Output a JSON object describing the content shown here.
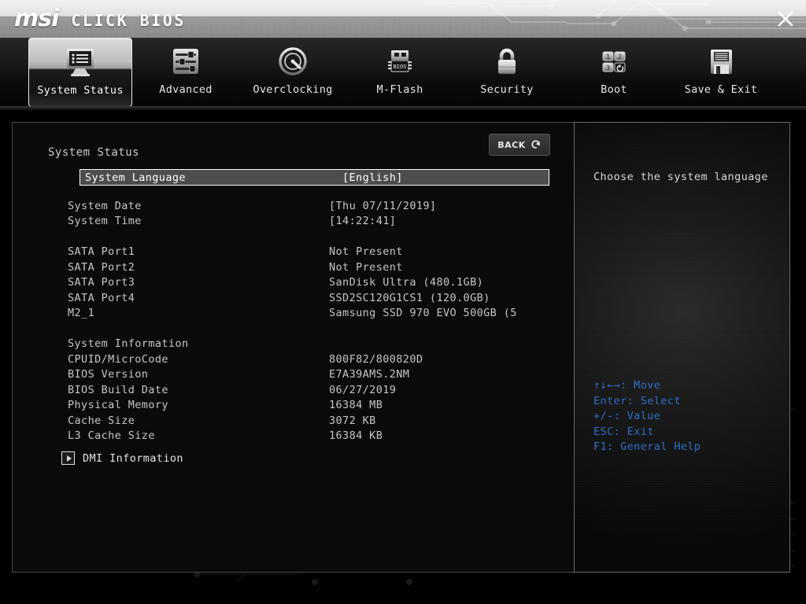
{
  "header": {
    "logo_msi": "msi",
    "logo_click_bios": "CLICK BIOS",
    "close_icon": "close-icon"
  },
  "nav": {
    "items": [
      {
        "label": "System Status",
        "icon": "monitor-list-icon",
        "active": true
      },
      {
        "label": "Advanced",
        "icon": "sliders-icon",
        "active": false
      },
      {
        "label": "Overclocking",
        "icon": "speedometer-icon",
        "active": false
      },
      {
        "label": "M-Flash",
        "icon": "bios-chip-icon",
        "active": false
      },
      {
        "label": "Security",
        "icon": "padlock-icon",
        "active": false
      },
      {
        "label": "Boot",
        "icon": "boot-order-icon",
        "active": false
      },
      {
        "label": "Save & Exit",
        "icon": "floppy-disk-icon",
        "active": false
      }
    ]
  },
  "main": {
    "title": "System Status",
    "back_button": {
      "label": "BACK",
      "icon": "undo-arrow-icon"
    },
    "highlighted_row": {
      "label": "System Language",
      "value": "[English]"
    },
    "rows": [
      {
        "label": "System Date",
        "value": "[Thu 07/11/2019]"
      },
      {
        "label": "System Time",
        "value": "[14:22:41]"
      },
      {
        "label": "",
        "value": ""
      },
      {
        "label": "SATA Port1",
        "value": "Not Present"
      },
      {
        "label": "SATA Port2",
        "value": "Not Present"
      },
      {
        "label": "SATA Port3",
        "value": "SanDisk Ultra  (480.1GB)"
      },
      {
        "label": "SATA Port4",
        "value": "SSD2SC120G1CS1 (120.0GB)"
      },
      {
        "label": "M2_1",
        "value": "Samsung SSD 970 EVO 500GB (5"
      },
      {
        "label": "",
        "value": ""
      },
      {
        "label": "System Information",
        "value": ""
      },
      {
        "label": "CPUID/MicroCode",
        "value": "800F82/800820D"
      },
      {
        "label": "BIOS Version",
        "value": "E7A39AMS.2NM"
      },
      {
        "label": "BIOS Build Date",
        "value": "06/27/2019"
      },
      {
        "label": "Physical Memory",
        "value": "16384 MB"
      },
      {
        "label": "Cache Size",
        "value": "3072 KB"
      },
      {
        "label": "L3 Cache Size",
        "value": "16384 KB"
      }
    ],
    "dmi": {
      "label": "DMI Information",
      "icon": "expand-triangle-icon"
    }
  },
  "help": {
    "description": "Choose the system language",
    "keys": [
      "↑↓←→: Move",
      "Enter: Select",
      "+/-: Value",
      "ESC: Exit",
      "F1: General Help"
    ],
    "key_color": "#2f6fc4"
  },
  "colors": {
    "highlight_bg": "#4d4d4d",
    "panel_bg": "#0a0a0a",
    "text": "#c6c6c6",
    "accent_blue": "#2f6fc4"
  }
}
